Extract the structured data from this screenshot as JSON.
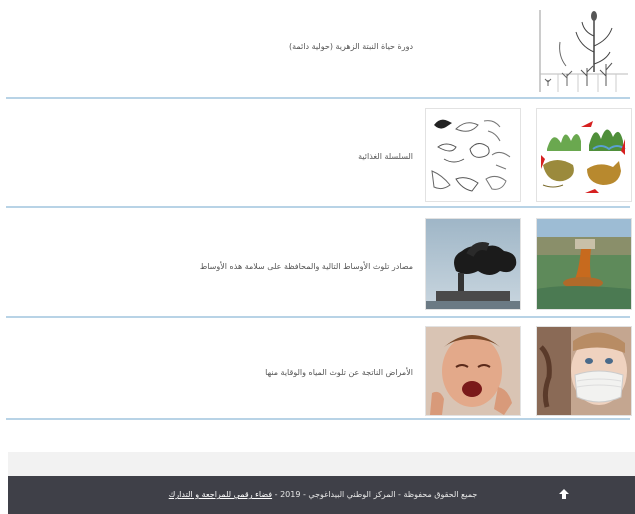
{
  "lessons": [
    {
      "title": "دورة حياة النبتة الزهرية (حولية دائمة)"
    },
    {
      "title": "السلسلة الغذائية"
    },
    {
      "title": "مصادر تلوث الأوساط التالية والمحافظة على سلامة هذه الأوساط"
    },
    {
      "title": "الأمراض الناتجة عن تلوث المياه والوقاية منها"
    }
  ],
  "footer": {
    "text": "جميع الحقوق محفوظة - المركز الوطني البيداغوجي - 2019 -",
    "link": "فضاء رقمي للمراجعة و التدارك",
    "up_icon": "arrow-up-icon"
  },
  "colors": {
    "divider": "#b8d3e6",
    "footer_bar": "#3f4048",
    "footer_bg": "#f2f2f2"
  }
}
